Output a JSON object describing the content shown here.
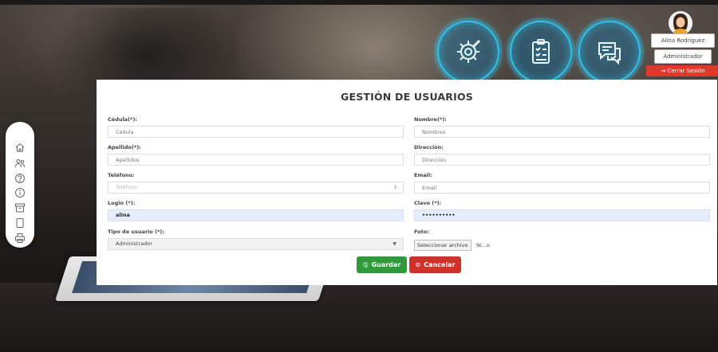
{
  "user": {
    "name": "Alina Rodriguez",
    "role": "Administrador",
    "logout_label": "Cerrar Sesión",
    "logout_icon": "logout-icon"
  },
  "hero_icons": [
    "gear-wrench-icon",
    "clipboard-checklist-icon",
    "chat-bubbles-icon"
  ],
  "sidebar": {
    "items": [
      {
        "icon": "home-icon"
      },
      {
        "icon": "users-icon"
      },
      {
        "icon": "help-icon"
      },
      {
        "icon": "info-icon"
      },
      {
        "icon": "archive-icon"
      },
      {
        "icon": "document-icon"
      },
      {
        "icon": "print-icon"
      }
    ]
  },
  "form": {
    "title": "GESTIÓN DE USUARIOS",
    "cedula": {
      "label": "Cédula(*):",
      "placeholder": "Cédula"
    },
    "nombre": {
      "label": "Nombre(*):",
      "placeholder": "Nombres"
    },
    "apellido": {
      "label": "Apellido(*):",
      "placeholder": "Apellidos"
    },
    "direccion": {
      "label": "Dirección:",
      "placeholder": "Dirección"
    },
    "telefono": {
      "label": "Teléfono:",
      "placeholder": "Teléfono"
    },
    "email": {
      "label": "Email:",
      "placeholder": "Email"
    },
    "login": {
      "label": "Login (*):",
      "value": "alina"
    },
    "clave": {
      "label": "Clave (*):",
      "value": "••••••••••"
    },
    "tipo": {
      "label": "Tipo de usuario (*):",
      "value": "Administrador"
    },
    "foto": {
      "label": "Foto:",
      "button": "Seleccionar archivo",
      "status": "Ni...o"
    },
    "save_label": "Guardar",
    "cancel_label": "Cancelar"
  },
  "colors": {
    "save": "#2e9a3c",
    "cancel": "#d2312b",
    "logout": "#e0392b",
    "hero_glow": "#2ec4ef"
  }
}
